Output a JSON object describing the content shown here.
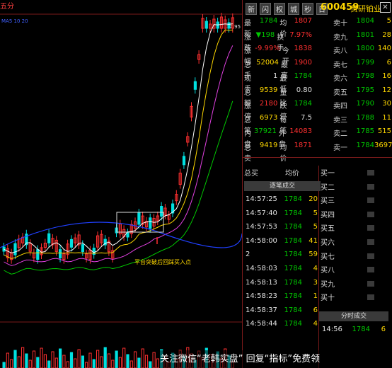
{
  "app": {
    "top_label": "五分",
    "small_label": "MA5 10 20"
  },
  "tabs": [
    "新",
    "闪",
    "权",
    "城",
    "秒",
    "日"
  ],
  "stock": {
    "code": "600459",
    "name": "贵研铂业"
  },
  "quote": [
    {
      "l1": "最新",
      "v1": "1784",
      "c1": "green",
      "l2": "均价",
      "v2": "1807",
      "c2": "red"
    },
    {
      "l1": "涨跌",
      "v1": "▼198",
      "c1": "green",
      "l2": "换手",
      "v2": "7.97%",
      "c2": "red"
    },
    {
      "l1": "涨幅",
      "v1": "-9.99%",
      "c1": "red",
      "l2": "今开",
      "v2": "1838",
      "c2": "red"
    },
    {
      "l1": "总手",
      "v1": "52004",
      "c1": "yellow",
      "l2": "最高",
      "v2": "1900",
      "c2": "red"
    },
    {
      "l1": "现手",
      "v1": "1",
      "c1": "white",
      "l2": "最低",
      "v2": "1784",
      "c2": "green"
    },
    {
      "l1": "总额",
      "v1": "9539",
      "c1": "yellow",
      "l2": "量比",
      "v2": "0.80",
      "c2": "white"
    },
    {
      "l1": "涨停",
      "v1": "2180",
      "c1": "red",
      "l2": "跌停",
      "v2": "1784",
      "c2": "green"
    },
    {
      "l1": "总笔",
      "v1": "6973",
      "c1": "yellow",
      "l2": "每笔",
      "v2": "7.5",
      "c2": "white"
    },
    {
      "l1": "内盘",
      "v1": "37921",
      "c1": "green",
      "l2": "外盘",
      "v2": "14083",
      "c2": "red"
    },
    {
      "l1": "总卖",
      "v1": "9419",
      "c1": "yellow",
      "l2": "均价",
      "v2": "1871",
      "c2": "red"
    }
  ],
  "orderbook": [
    {
      "label": "卖十",
      "price": "1804",
      "vol": "5"
    },
    {
      "label": "卖九",
      "price": "1801",
      "vol": "28"
    },
    {
      "label": "卖八",
      "price": "1800",
      "vol": "140"
    },
    {
      "label": "卖七",
      "price": "1799",
      "vol": "6"
    },
    {
      "label": "卖六",
      "price": "1798",
      "vol": "16"
    },
    {
      "label": "卖五",
      "price": "1795",
      "vol": "12"
    },
    {
      "label": "卖四",
      "price": "1790",
      "vol": "30"
    },
    {
      "label": "卖三",
      "price": "1788",
      "vol": "11"
    },
    {
      "label": "卖二",
      "price": "1785",
      "vol": "515"
    },
    {
      "label": "卖一",
      "price": "1784",
      "vol": "3697"
    }
  ],
  "total_buy": {
    "label": "总买",
    "avg_label": "均价"
  },
  "tick_header": "逐笔成交",
  "ticks": [
    {
      "t": "14:57:25",
      "p": "1784",
      "v": "20"
    },
    {
      "t": "14:57:40",
      "p": "1784",
      "v": "5"
    },
    {
      "t": "14:57:53",
      "p": "1784",
      "v": "5"
    },
    {
      "t": "14:58:00",
      "p": "1784",
      "v": "41"
    },
    {
      "t": "2",
      "p": "1784",
      "v": "59"
    },
    {
      "t": "14:58:03",
      "p": "1784",
      "v": "4"
    },
    {
      "t": "14:58:13",
      "p": "1784",
      "v": "3"
    },
    {
      "t": "14:58:23",
      "p": "1784",
      "v": "1"
    },
    {
      "t": "14:58:37",
      "p": "1784",
      "v": "6"
    },
    {
      "t": "14:58:44",
      "p": "1784",
      "v": "4"
    }
  ],
  "buy_levels": [
    "买一",
    "买二",
    "买三",
    "买四",
    "买五",
    "买六",
    "买七",
    "买八",
    "买九",
    "买十"
  ],
  "minute_tab": "分时成交",
  "minute_tick": {
    "t": "14:56",
    "p": "1784",
    "v": "6"
  },
  "chart_annotation": "平台突破后回踩买入点",
  "chart_top": "32.95",
  "footer": "关注微信“老韩实盘” 回复“指标”免费领"
}
